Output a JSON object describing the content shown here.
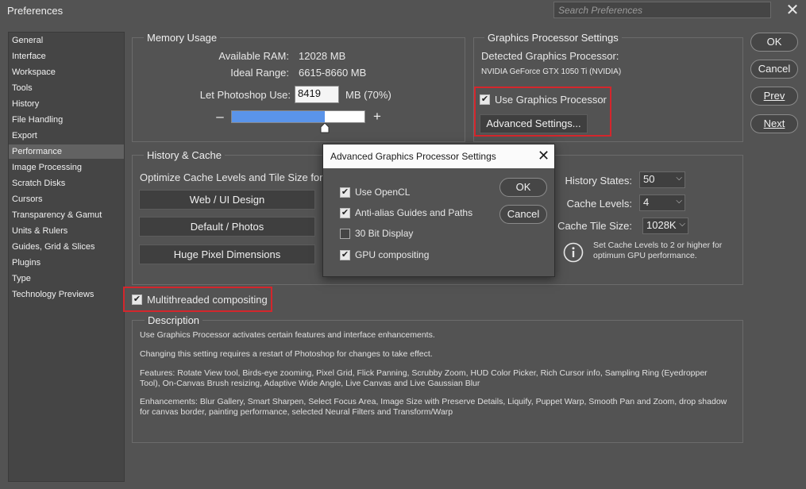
{
  "window": {
    "title": "Preferences",
    "search_placeholder": "Search Preferences",
    "close": "✕"
  },
  "sidebar": {
    "items": [
      {
        "label": "General"
      },
      {
        "label": "Interface"
      },
      {
        "label": "Workspace"
      },
      {
        "label": "Tools"
      },
      {
        "label": "History"
      },
      {
        "label": "File Handling"
      },
      {
        "label": "Export"
      },
      {
        "label": "Performance",
        "selected": true
      },
      {
        "label": "Image Processing"
      },
      {
        "label": "Scratch Disks"
      },
      {
        "label": "Cursors"
      },
      {
        "label": "Transparency & Gamut"
      },
      {
        "label": "Units & Rulers"
      },
      {
        "label": "Guides, Grid & Slices"
      },
      {
        "label": "Plugins"
      },
      {
        "label": "Type"
      },
      {
        "label": "Technology Previews"
      }
    ]
  },
  "memory": {
    "title": "Memory Usage",
    "available_label": "Available RAM:",
    "available_value": "12028 MB",
    "ideal_label": "Ideal Range:",
    "ideal_value": "6615-8660 MB",
    "use_label": "Let Photoshop Use:",
    "use_value": "8419",
    "use_suffix": "MB (70%)",
    "slider_percent": 70,
    "minus": "–",
    "plus": "+"
  },
  "gpu": {
    "title": "Graphics Processor Settings",
    "detected_label": "Detected Graphics Processor:",
    "detected_value": "NVIDIA GeForce GTX 1050 Ti (NVIDIA)",
    "use_gpu_label": "Use Graphics Processor",
    "use_gpu_checked": true,
    "advanced_button": "Advanced Settings..."
  },
  "history_cache": {
    "title": "History & Cache",
    "optimize_label": "Optimize Cache Levels and Tile Size for:",
    "preset_buttons": [
      "Web / UI Design",
      "Default / Photos",
      "Huge Pixel Dimensions"
    ],
    "history_states_label": "History States:",
    "history_states_value": "50",
    "cache_levels_label": "Cache Levels:",
    "cache_levels_value": "4",
    "cache_tile_label": "Cache Tile Size:",
    "cache_tile_value": "1028K",
    "info_note": "Set Cache Levels to 2 or higher for optimum GPU performance."
  },
  "multithreaded": {
    "label": "Multithreaded compositing",
    "checked": true
  },
  "description": {
    "title": "Description",
    "paragraphs": [
      "Use Graphics Processor activates certain features and interface enhancements.",
      "Changing this setting requires a restart of Photoshop for changes to take effect.",
      "Features: Rotate View tool, Birds-eye zooming, Pixel Grid, Flick Panning, Scrubby Zoom, HUD Color Picker, Rich Cursor info, Sampling Ring (Eyedropper Tool), On-Canvas Brush resizing, Adaptive Wide Angle, Live Canvas and Live Gaussian Blur",
      "Enhancements: Blur Gallery, Smart Sharpen, Select Focus Area, Image Size with Preserve Details, Liquify, Puppet Warp, Smooth Pan and Zoom, drop shadow for canvas border, painting performance, selected Neural Filters and Transform/Warp"
    ]
  },
  "buttons": {
    "ok": "OK",
    "cancel": "Cancel",
    "prev": "Prev",
    "next": "Next"
  },
  "dialog": {
    "title": "Advanced Graphics Processor Settings",
    "close": "✕",
    "options": [
      {
        "label": "Use OpenCL",
        "checked": true
      },
      {
        "label": "Anti-alias Guides and Paths",
        "checked": true
      },
      {
        "label": "30 Bit Display",
        "checked": false
      },
      {
        "label": "GPU compositing",
        "checked": true
      }
    ],
    "ok": "OK",
    "cancel": "Cancel"
  },
  "colors": {
    "accent_slider": "#5a94ea",
    "highlight_border": "#d4262c"
  }
}
